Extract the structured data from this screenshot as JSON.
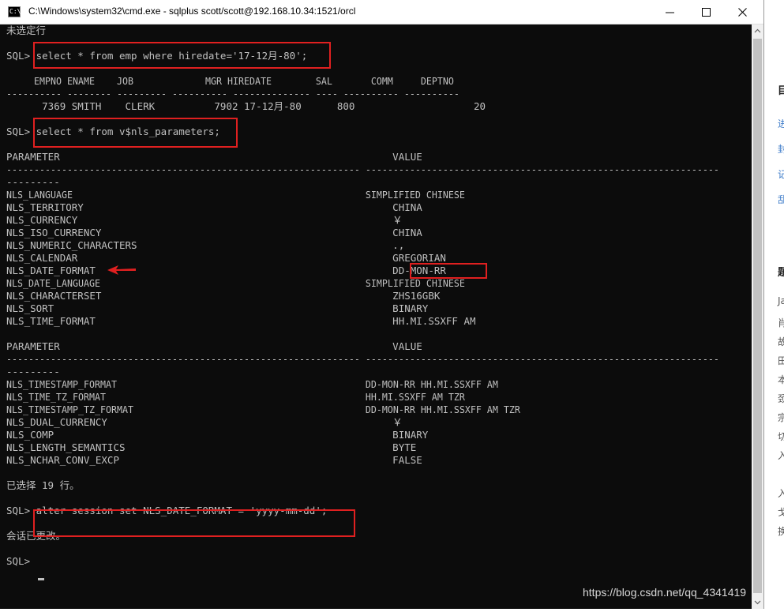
{
  "window": {
    "title": "C:\\Windows\\system32\\cmd.exe - sqlplus  scott/scott@192.168.10.34:1521/orcl",
    "icon_label": "C:\\"
  },
  "console": {
    "lines": [
      "未选定行",
      "",
      "SQL> select * from emp where hiredate='17-12月-80';",
      "",
      "     EMPNO ENAME    JOB             MGR HIREDATE        SAL       COMM     DEPTNO",
      "---------- -------- --------- ---------- -------------- ---- ---------- ----------",
      "      7369 SMITH    CLERK          7902 17-12月-80      800                    20",
      "",
      "SQL> select * from v$nls_parameters;",
      "",
      "PARAMETER                                                        VALUE",
      "---------------------------------------------------------------- ----------------------------------------------------------------",
      "---------",
      "NLS_LANGUAGE                                                     SIMPLIFIED CHINESE",
      "NLS_TERRITORY                                                    CHINA",
      "NLS_CURRENCY                                                     ￥",
      "NLS_ISO_CURRENCY                                                 CHINA",
      "NLS_NUMERIC_CHARACTERS                                           .,",
      "NLS_CALENDAR                                                     GREGORIAN",
      "NLS_DATE_FORMAT                                                  DD-MON-RR",
      "NLS_DATE_LANGUAGE                                                SIMPLIFIED CHINESE",
      "NLS_CHARACTERSET                                                 ZHS16GBK",
      "NLS_SORT                                                         BINARY",
      "NLS_TIME_FORMAT                                                  HH.MI.SSXFF AM",
      "",
      "PARAMETER                                                        VALUE",
      "---------------------------------------------------------------- ----------------------------------------------------------------",
      "---------",
      "NLS_TIMESTAMP_FORMAT                                             DD-MON-RR HH.MI.SSXFF AM",
      "NLS_TIME_TZ_FORMAT                                               HH.MI.SSXFF AM TZR",
      "NLS_TIMESTAMP_TZ_FORMAT                                          DD-MON-RR HH.MI.SSXFF AM TZR",
      "NLS_DUAL_CURRENCY                                                ￥",
      "NLS_COMP                                                         BINARY",
      "NLS_LENGTH_SEMANTICS                                             BYTE",
      "NLS_NCHAR_CONV_EXCP                                              FALSE",
      "",
      "已选择 19 行。",
      "",
      "SQL> alter session set NLS_DATE_FORMAT = 'yyyy-mm-dd';",
      "",
      "会话已更改。",
      "",
      "SQL> "
    ]
  },
  "watermark": "https://blog.csdn.net/qq_4341419",
  "background_page_fragments": [
    "目",
    "进",
    "封",
    "记",
    "乱",
    "题",
    "Ja",
    "肖",
    "故",
    "田",
    "本",
    "颈",
    "宗",
    "切",
    "入",
    "入",
    "戈",
    "换"
  ],
  "colors": {
    "console_bg": "#0c0c0c",
    "console_text": "#c0c0c0",
    "highlight": "#e02020",
    "titlebar_bg": "#ffffff"
  }
}
